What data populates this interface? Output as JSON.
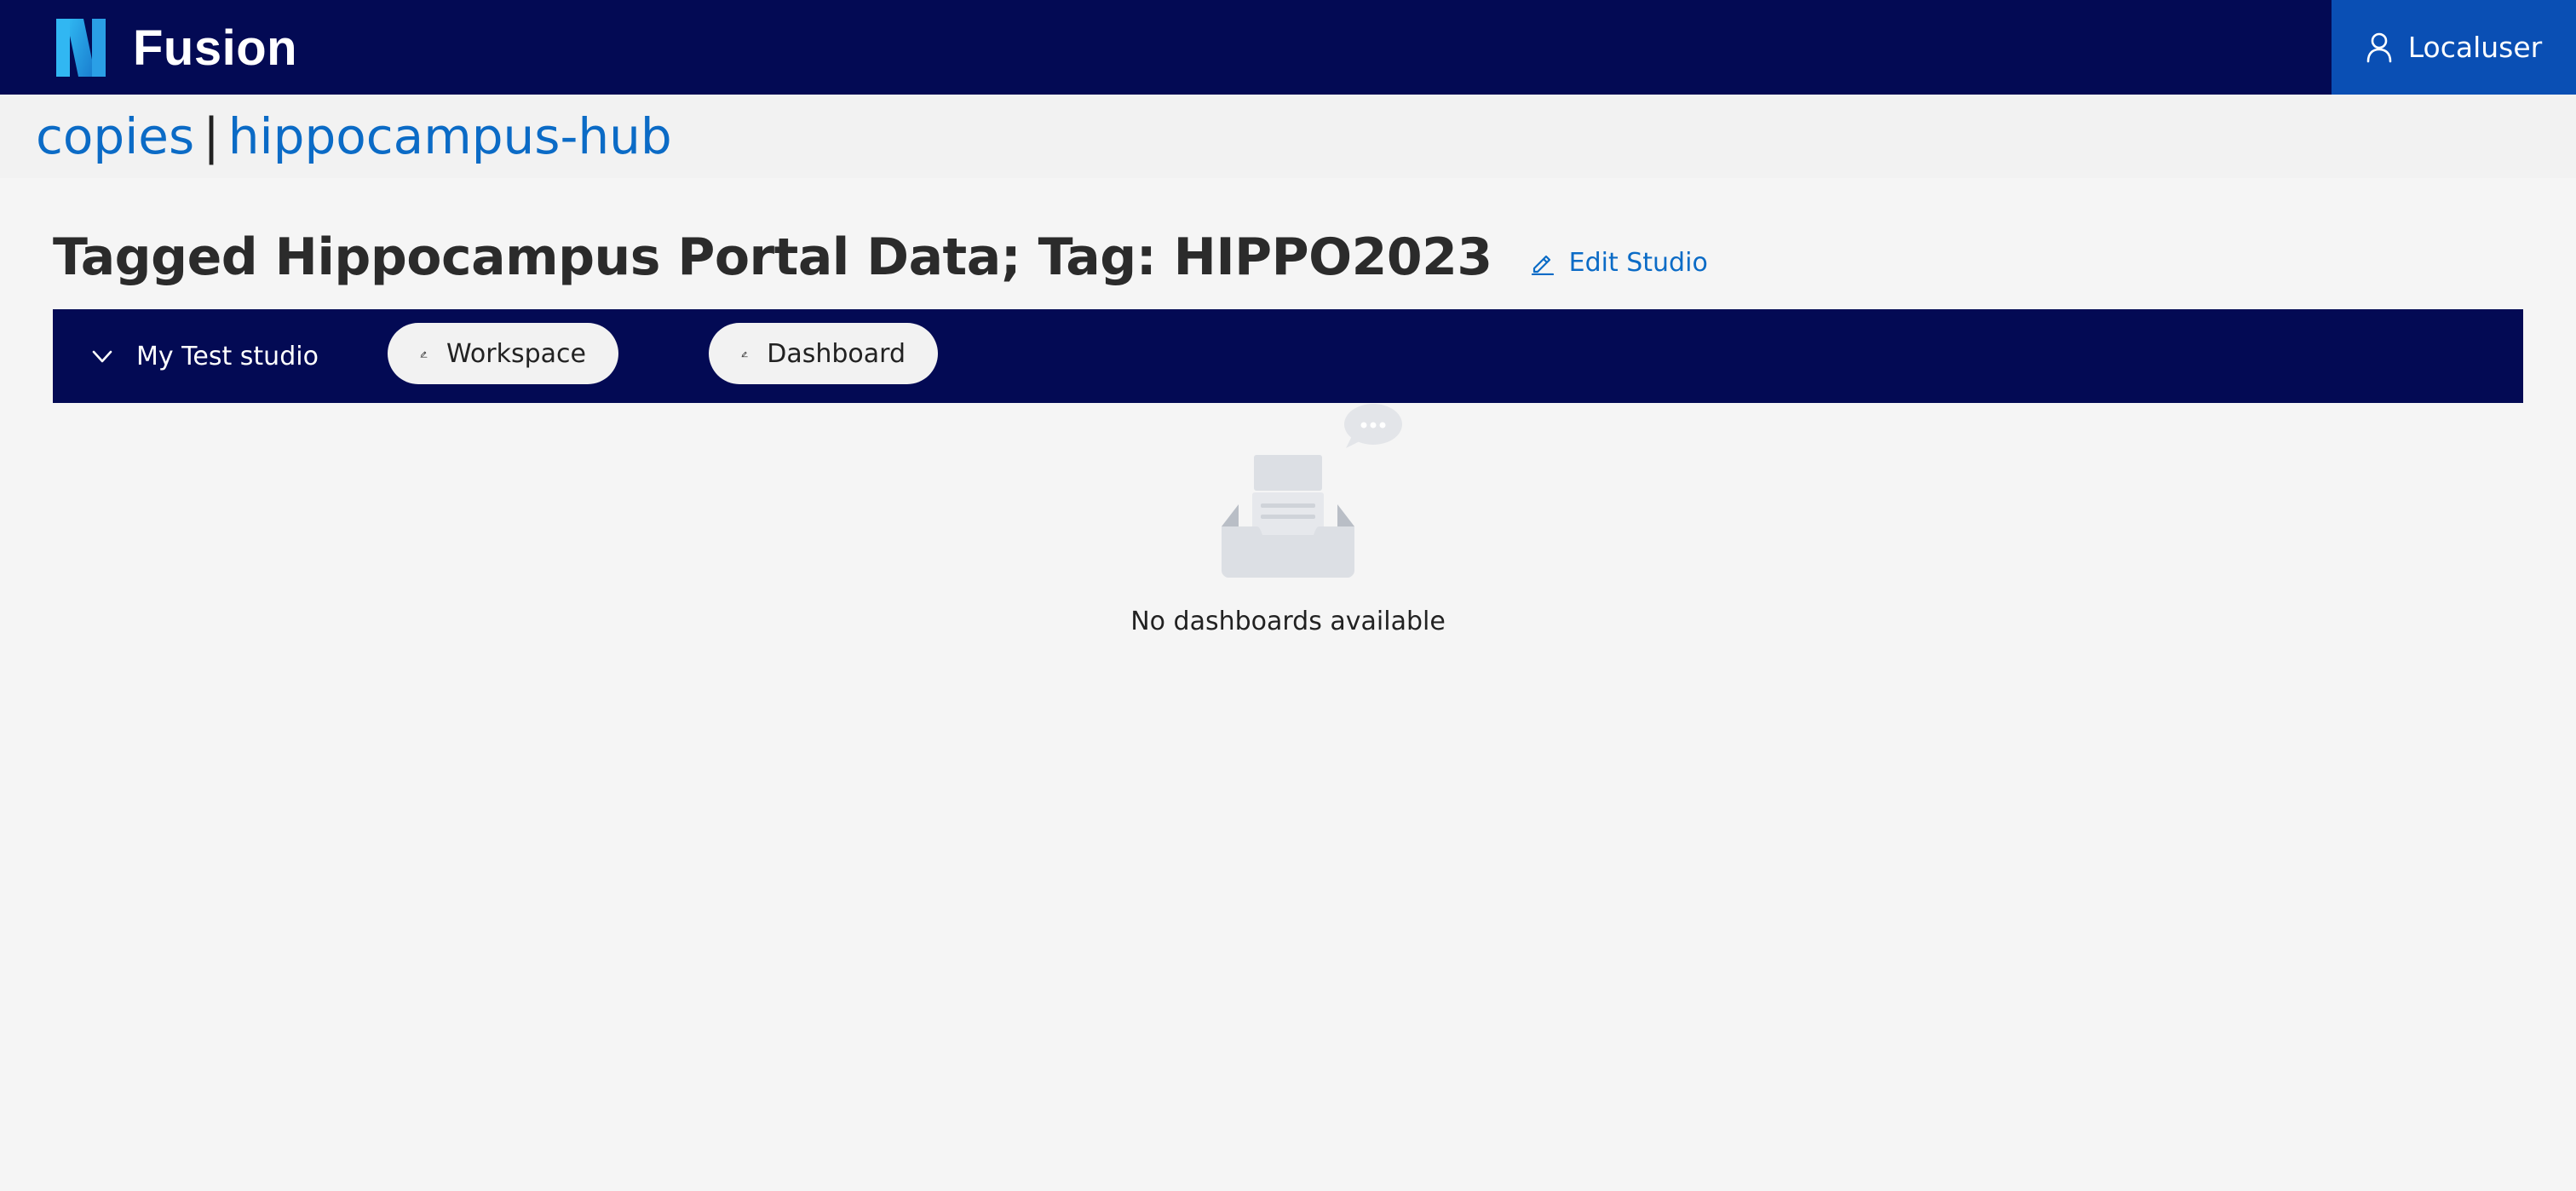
{
  "header": {
    "brand": "Fusion",
    "user_label": "Localuser"
  },
  "breadcrumb": {
    "items": [
      "copies",
      "hippocampus-hub"
    ],
    "separator": "|"
  },
  "page": {
    "title": "Tagged Hippocampus Portal Data; Tag: HIPPO2023",
    "edit_label": "Edit Studio"
  },
  "studio": {
    "name": "My Test studio",
    "workspace_label": "Workspace",
    "dashboard_label": "Dashboard"
  },
  "empty_state": {
    "message": "No dashboards available"
  },
  "colors": {
    "header_bg": "#030a54",
    "user_btn_bg": "#0a4fb4",
    "link": "#0b6bc6",
    "page_bg": "#f5f5f5"
  },
  "icons": {
    "logo": "fusion-logo",
    "user": "user-icon",
    "edit": "pencil-icon",
    "toggle": "chevron-down-icon",
    "empty": "empty-inbox-icon"
  }
}
